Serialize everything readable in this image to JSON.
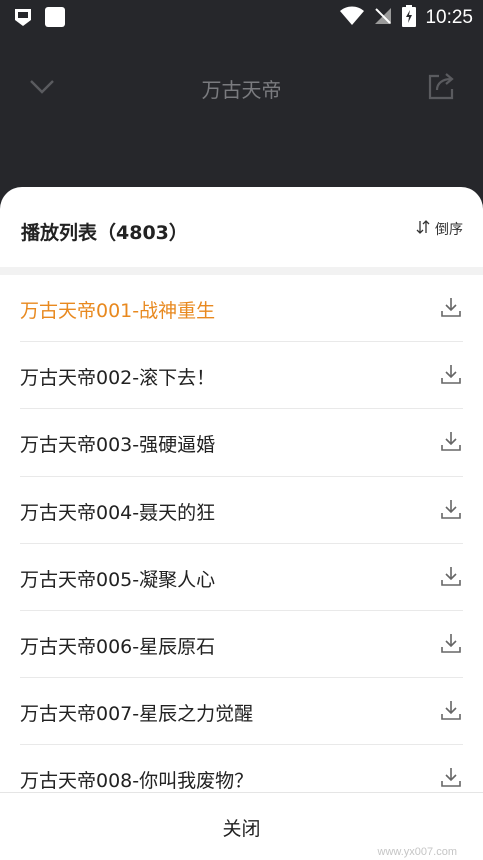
{
  "status_bar": {
    "time": "10:25",
    "icons": [
      "shield-icon",
      "square-icon",
      "wifi-icon",
      "no-signal-icon",
      "battery-icon"
    ]
  },
  "top_bar": {
    "title": "万古天帝"
  },
  "playlist": {
    "title": "播放列表（4803）",
    "sort_label": "倒序",
    "accent_color": "#e8891f",
    "episodes": [
      {
        "title": "万古天帝001-战神重生",
        "active": true
      },
      {
        "title": "万古天帝002-滚下去！",
        "active": false
      },
      {
        "title": "万古天帝003-强硬逼婚",
        "active": false
      },
      {
        "title": "万古天帝004-聂天的狂",
        "active": false
      },
      {
        "title": "万古天帝005-凝聚人心",
        "active": false
      },
      {
        "title": "万古天帝006-星辰原石",
        "active": false
      },
      {
        "title": "万古天帝007-星辰之力觉醒",
        "active": false
      },
      {
        "title": "万古天帝008-你叫我废物？",
        "active": false
      }
    ]
  },
  "footer": {
    "close_label": "关闭",
    "watermark": "www.yx007.com"
  }
}
